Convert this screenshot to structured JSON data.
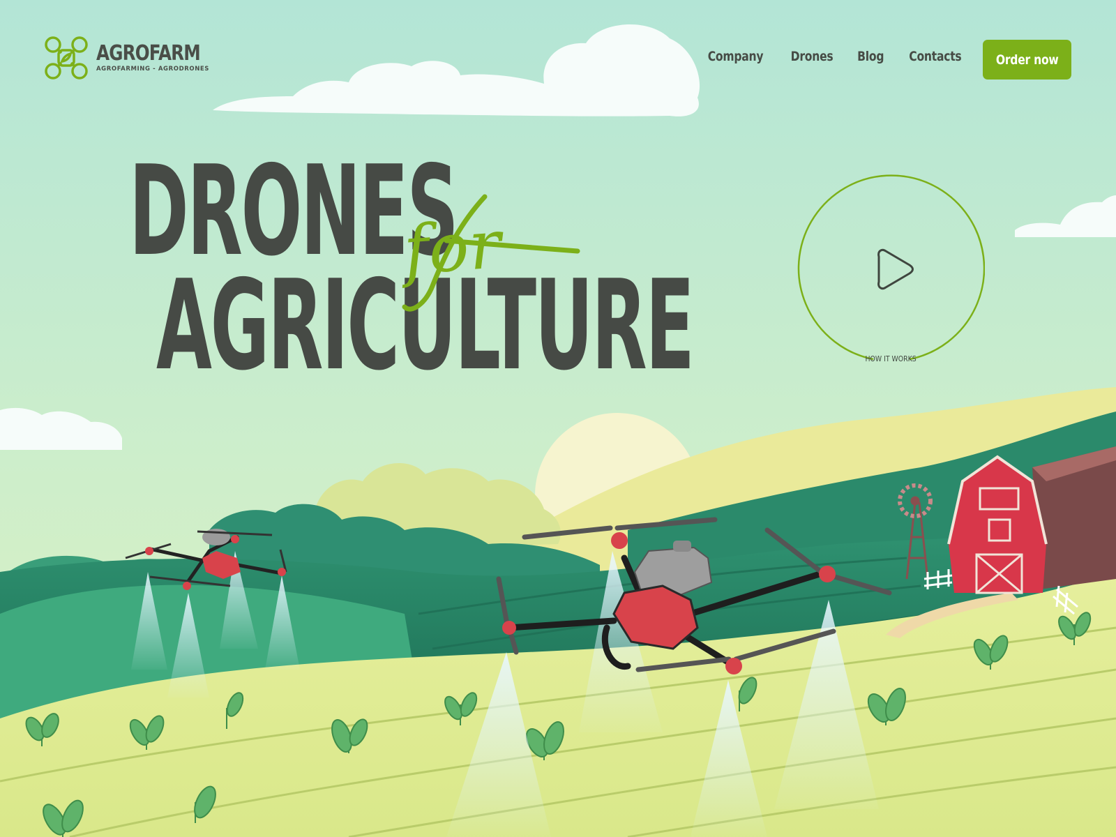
{
  "brand": {
    "name": "AGROFARM",
    "tagline": "AGROFARMING - AGRODRONES",
    "accent": "#7cb019",
    "text_color": "#464a45"
  },
  "nav": {
    "items": [
      {
        "label": "Company"
      },
      {
        "label": "Drones"
      },
      {
        "label": "Blog"
      },
      {
        "label": "Contacts"
      }
    ],
    "cta_label": "Order now"
  },
  "hero": {
    "line1": "DRONES",
    "script_word": "for",
    "line2": "AGRICULTURE"
  },
  "video": {
    "label": "HOW IT WORKS",
    "icon": "play-icon"
  },
  "colors": {
    "sky_top": "#b4e6d8",
    "sky_bottom": "#d8f0c8",
    "barn_red": "#d8374a",
    "drone_red": "#d8434b",
    "field_green": "#2f8a6a",
    "field_light": "#e3eca0"
  }
}
